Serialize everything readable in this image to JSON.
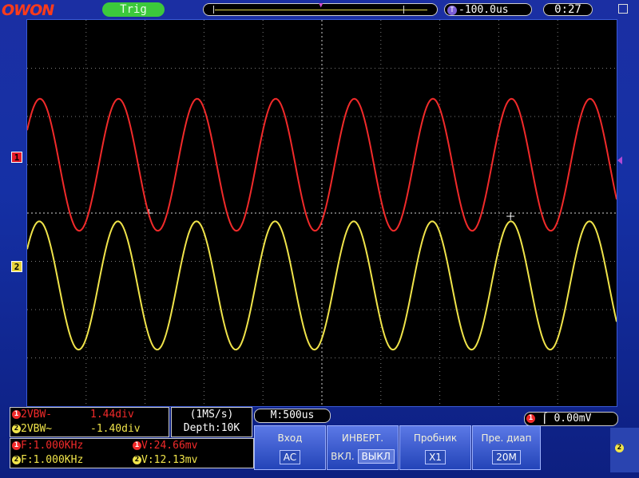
{
  "topbar": {
    "logo": "OWON",
    "trig_status": "Trig",
    "time_delay_badge": "T",
    "time_delay": "-100.0us",
    "clock": "0:27"
  },
  "markers": {
    "ch1": "1",
    "ch2": "2",
    "trigger_pos": "T"
  },
  "colors": {
    "ch1": "#f12a2a",
    "ch2": "#f0e44a",
    "grid": "#7a7a7a"
  },
  "waveforms": {
    "ch1": {
      "periods_per_screen": 7.5,
      "amplitude_div": 1.44,
      "offset_div": 1.0
    },
    "ch2": {
      "periods_per_screen": 7.5,
      "amplitude_div": 1.4,
      "offset_div": -1.5
    }
  },
  "info": {
    "ch1_line": "2VBW-",
    "ch1_value": "1.44div",
    "ch2_line": "2VBW~",
    "ch2_value": "-1.40div",
    "ch1_badge": "1",
    "ch2_badge": "2"
  },
  "rate": {
    "sample": "(1MS/s)",
    "depth": "Depth:10K"
  },
  "measure": {
    "ch1_freq": "F:1.000KHz",
    "ch2_freq": "F:1.000KHz",
    "ch1_volt": "V:24.66mv",
    "ch2_volt": "V:12.13mv"
  },
  "timebase": "M:500us",
  "trigger_level": "0.00mV",
  "menu": [
    {
      "label": "Вход",
      "value": "AC"
    },
    {
      "label": "ИНВЕРТ.",
      "value_a": "ВКЛ.",
      "value_b": "ВЫКЛ"
    },
    {
      "label": "Пробник",
      "value": "X1"
    },
    {
      "label": "Пре. диап",
      "value": "20M"
    }
  ],
  "side_badge": "2"
}
